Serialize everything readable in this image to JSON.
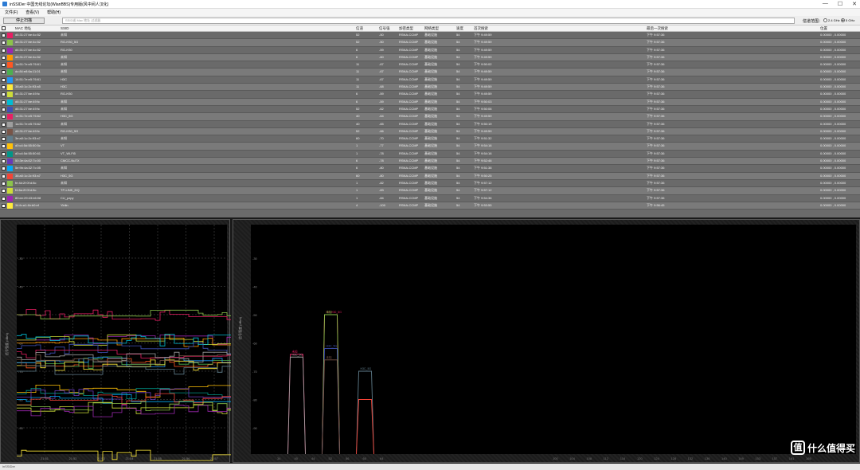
{
  "window": {
    "title": "inSSIDer 中国无线论坛(WlanBBS)专用版(风中间人汉化)",
    "min": "—",
    "max": "☐",
    "close": "✕"
  },
  "menu": [
    "文件(F)",
    "查看(V)",
    "帮助(H)"
  ],
  "toolbar": {
    "scan_label": "停止扫描",
    "filter_placeholder": "SSID或 Mac 地址 过滤器",
    "band_label": "信道范围：",
    "band_24": "2.4 GHz",
    "band_5": "5 GHz"
  },
  "table": {
    "headers": [
      "MAC 地址",
      "SSID",
      "信道",
      "信号强",
      "加密类型",
      "网络类型",
      "速度",
      "首次搜索",
      "最后一次搜索",
      "位置"
    ],
    "rows": [
      {
        "mac": "d6:31:27:be:4c:52",
        "ssid": "未知",
        "ch": "52",
        "sig": "-50",
        "enc": "RSNA-CCMP",
        "net": "基础设施",
        "rate": "54",
        "first": "下午 9:49:59",
        "last": "下午 9:57:36",
        "loc": "0.00000 , 0.00000",
        "color": "#e81e63"
      },
      {
        "mac": "d6:31:27:be:4c:52",
        "ssid": "RG-H30_5G",
        "ch": "52",
        "sig": "-50",
        "enc": "RSNA-CCMP",
        "net": "基础设施",
        "rate": "54",
        "first": "下午 9:49:59",
        "last": "下午 9:57:36",
        "loc": "0.00000 , 0.00000",
        "color": "#8bc34a"
      },
      {
        "mac": "d4:31:27:be:4c:52",
        "ssid": "RG-H30",
        "ch": "6",
        "sig": "-59",
        "enc": "RSNA-CCMP",
        "net": "基础设施",
        "rate": "54",
        "first": "下午 9:49:59",
        "last": "下午 9:57:36",
        "loc": "0.00000 , 0.00000",
        "color": "#9c27b0"
      },
      {
        "mac": "d6:31:27:be:4c:52",
        "ssid": "未知",
        "ch": "6",
        "sig": "-60",
        "enc": "RSNA-CCMP",
        "net": "基础设施",
        "rate": "54",
        "first": "下午 9:49:59",
        "last": "下午 9:57:36",
        "loc": "0.00000 , 0.00000",
        "color": "#ff9800"
      },
      {
        "mac": "1a:51:7e:e5:76:61",
        "ssid": "未知",
        "ch": "11",
        "sig": "-67",
        "enc": "RSNA-CCMP",
        "net": "基础设施",
        "rate": "54",
        "first": "下午 9:50:02",
        "last": "下午 9:57:36",
        "loc": "0.00000 , 0.00000",
        "color": "#ff5722"
      },
      {
        "mac": "dc:84:e8:6a:11:01",
        "ssid": "未知",
        "ch": "11",
        "sig": "-67",
        "enc": "RSNA-CCMP",
        "net": "基础设施",
        "rate": "54",
        "first": "下午 9:49:59",
        "last": "下午 9:57:36",
        "loc": "0.00000 , 0.00000",
        "color": "#4caf50"
      },
      {
        "mac": "14:51:7e:e5:76:61",
        "ssid": "H3C",
        "ch": "11",
        "sig": "-67",
        "enc": "RSNA-CCMP",
        "net": "基础设施",
        "rate": "54",
        "first": "下午 9:49:59",
        "last": "下午 9:57:36",
        "loc": "0.00000 , 0.00000",
        "color": "#2196f3"
      },
      {
        "mac": "38:a0:1c:2c:93:a5",
        "ssid": "H3C",
        "ch": "11",
        "sig": "-68",
        "enc": "RSNA-CCMP",
        "net": "基础设施",
        "rate": "54",
        "first": "下午 9:49:59",
        "last": "下午 9:57:36",
        "loc": "0.00000 , 0.00000",
        "color": "#ffeb3b"
      },
      {
        "mac": "d4:31:27:be:49:fc",
        "ssid": "RG-H30",
        "ch": "6",
        "sig": "-59",
        "enc": "RSNA-CCMP",
        "net": "基础设施",
        "rate": "54",
        "first": "下午 9:49:59",
        "last": "下午 9:57:36",
        "loc": "0.00000 , 0.00000",
        "color": "#cddc39"
      },
      {
        "mac": "d6:31:27:be:49:fc",
        "ssid": "未知",
        "ch": "6",
        "sig": "-59",
        "enc": "RSNA-CCMP",
        "net": "基础设施",
        "rate": "54",
        "first": "下午 9:50:03",
        "last": "下午 9:57:36",
        "loc": "0.00000 , 0.00000",
        "color": "#00bcd4"
      },
      {
        "mac": "d6:31:27:be:49:fc",
        "ssid": "未知",
        "ch": "52",
        "sig": "-62",
        "enc": "RSNA-CCMP",
        "net": "基础设施",
        "rate": "54",
        "first": "下午 9:50:06",
        "last": "下午 9:57:36",
        "loc": "0.00000 , 0.00000",
        "color": "#3f51b5"
      },
      {
        "mac": "14:51:7e:e5:76:62",
        "ssid": "H3C_5G",
        "ch": "40",
        "sig": "-64",
        "enc": "RSNA-CCMP",
        "net": "基础设施",
        "rate": "54",
        "first": "下午 9:49:59",
        "last": "下午 9:57:36",
        "loc": "0.00000 , 0.00000",
        "color": "#e91e63"
      },
      {
        "mac": "1a:51:7e:e5:76:62",
        "ssid": "未知",
        "ch": "40",
        "sig": "-65",
        "enc": "RSNA-CCMP",
        "net": "基础设施",
        "rate": "54",
        "first": "下午 9:50:19",
        "last": "下午 9:57:36",
        "loc": "0.00000 , 0.00000",
        "color": "#9e9e9e"
      },
      {
        "mac": "d6:31:27:be:49:fc",
        "ssid": "RG-H30_5G",
        "ch": "52",
        "sig": "-66",
        "enc": "RSNA-CCMP",
        "net": "基础设施",
        "rate": "54",
        "first": "下午 9:49:59",
        "last": "下午 9:57:36",
        "loc": "0.00000 , 0.00000",
        "color": "#795548"
      },
      {
        "mac": "3e:a0:1c:2c:93:a7",
        "ssid": "未知",
        "ch": "60",
        "sig": "-70",
        "enc": "RSNA-CCMP",
        "net": "基础设施",
        "rate": "54",
        "first": "下午 9:51:32",
        "last": "下午 9:57:36",
        "loc": "0.00000 , 0.00000",
        "color": "#607d8b"
      },
      {
        "mac": "d0:c4:5d:55:50:5c",
        "ssid": "VT",
        "ch": "1",
        "sig": "-77",
        "enc": "RSNA-CCMP",
        "net": "基础设施",
        "rate": "54",
        "first": "下午 9:54:16",
        "last": "下午 9:57:36",
        "loc": "0.00000 , 0.00000",
        "color": "#ffc107"
      },
      {
        "mac": "d0:c4:5d:55:50:61",
        "ssid": "VT_Wi-Fi5",
        "ch": "1",
        "sig": "-78",
        "enc": "RSNA-CCMP",
        "net": "基础设施",
        "rate": "54",
        "first": "下午 9:54:16",
        "last": "下午 9:57:36",
        "loc": "0.00000 , 0.00000",
        "color": "#009688"
      },
      {
        "mac": "50:3e:4a:02:7c:00",
        "ssid": "CMCC-NuTX",
        "ch": "6",
        "sig": "-78",
        "enc": "RSNA-CCMP",
        "net": "基础设施",
        "rate": "54",
        "first": "下午 9:52:46",
        "last": "下午 9:57:36",
        "loc": "0.00000 , 0.00000",
        "color": "#673ab7"
      },
      {
        "mac": "5e:9b:4a:32:7c:05",
        "ssid": "未知",
        "ch": "6",
        "sig": "-80",
        "enc": "RSNA-CCMP",
        "net": "基础设施",
        "rate": "54",
        "first": "下午 9:51:38",
        "last": "下午 9:57:36",
        "loc": "0.00000 , 0.00000",
        "color": "#03a9f4"
      },
      {
        "mac": "38:a0:1c:2c:93:a7",
        "ssid": "H3C_5G",
        "ch": "60",
        "sig": "-80",
        "enc": "RSNA-CCMP",
        "net": "基础设施",
        "rate": "54",
        "first": "下午 9:50:25",
        "last": "下午 9:57:36",
        "loc": "0.00000 , 0.00000",
        "color": "#f44336"
      },
      {
        "mac": "fe:4d:2f:0f:d:8c",
        "ssid": "未知",
        "ch": "1",
        "sig": "-82",
        "enc": "RSNA-CCMP",
        "net": "基础设施",
        "rate": "54",
        "first": "下午 9:57:12",
        "last": "下午 9:57:36",
        "loc": "0.00000 , 0.00000",
        "color": "#8bc34a"
      },
      {
        "mac": "f4:6a:2f:0f:d:8c",
        "ssid": "TP-LINK_DQ",
        "ch": "1",
        "sig": "-83",
        "enc": "RSNA-CCMP",
        "net": "基础设施",
        "rate": "54",
        "first": "下午 9:57:12",
        "last": "下午 9:57:36",
        "loc": "0.00000 , 0.00000",
        "color": "#cddc39"
      },
      {
        "mac": "80:ee:29:43:b6:08",
        "ssid": "CU_pzpy",
        "ch": "1",
        "sig": "-84",
        "enc": "RSNA-CCMP",
        "net": "基础设施",
        "rate": "54",
        "first": "下午 9:54:36",
        "last": "下午 9:57:36",
        "loc": "0.00000 , 0.00000",
        "color": "#9c27b0"
      },
      {
        "mac": "34:fc:a1:4b:b0:ef",
        "ssid": "Yinlin",
        "ch": "4",
        "sig": "-100",
        "enc": "RSNA-CCMP",
        "net": "基础设施",
        "rate": "54",
        "first": "下午 9:53:55",
        "last": "下午 9:56:45",
        "loc": "0.00000 , 0.00000",
        "color": "#ffeb3b"
      }
    ]
  },
  "time_graph": {
    "y_ticks": [
      "-30",
      "-40",
      "-50",
      "-60",
      "-70",
      "-80",
      "-90"
    ],
    "y_label": "信号强度 (dBm)",
    "x_ticks": [
      "21:51",
      "21:52",
      "21:53",
      "21:54",
      "21:55",
      "21:56",
      "21:57"
    ]
  },
  "channel_graph": {
    "y_ticks": [
      "-30",
      "-40",
      "-50",
      "-60",
      "-70",
      "-80",
      "-90"
    ],
    "y_label": "信号强度 (dBm)",
    "x_ticks": [
      "34",
      "40",
      "44",
      "52",
      "56",
      "60",
      "64",
      "100",
      "104",
      "108",
      "112",
      "116",
      "120",
      "124",
      "128",
      "132",
      "136",
      "140",
      "149",
      "153",
      "157",
      "161",
      "165"
    ],
    "network_labels": [
      "RG-H30_5G",
      "未知",
      "H3C_5G",
      "未知",
      "H3C_5G",
      "未知",
      "H3C_5G"
    ]
  },
  "watermark": {
    "icon": "值",
    "text": "什么值得买"
  },
  "status": "inSSIDer"
}
